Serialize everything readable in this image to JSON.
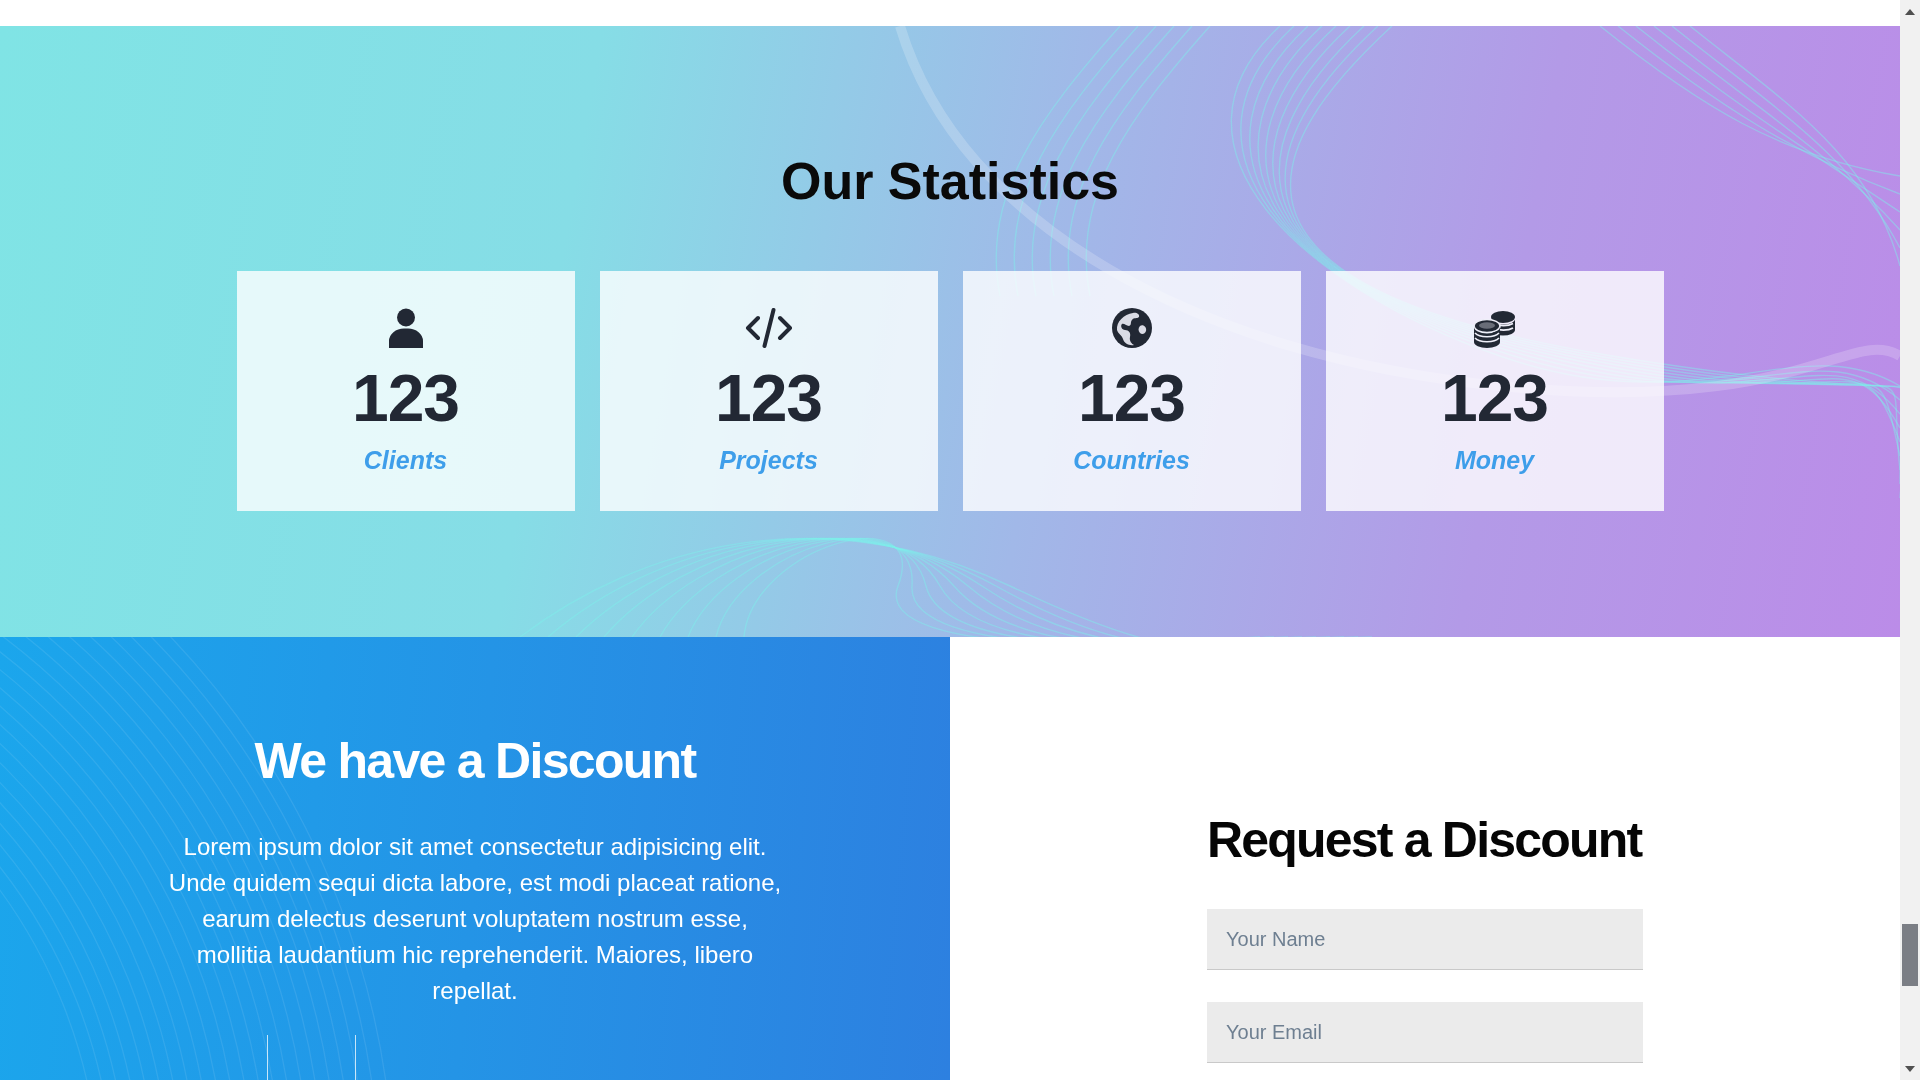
{
  "statistics": {
    "title": "Our Statistics",
    "cards": [
      {
        "value": "123",
        "label": "Clients"
      },
      {
        "value": "123",
        "label": "Projects"
      },
      {
        "value": "123",
        "label": "Countries"
      },
      {
        "value": "123",
        "label": "Money"
      }
    ]
  },
  "discount": {
    "title": "We have a Discount",
    "text": "Lorem ipsum dolor sit amet consectetur adipisicing elit. Unde quidem sequi dicta labore, est modi placeat ratione, earum delectus deserunt voluptatem nostrum esse, mollitia laudantium hic reprehenderit. Maiores, libero repellat."
  },
  "request_form": {
    "title": "Request a Discount",
    "fields": [
      {
        "placeholder": "Your Name"
      },
      {
        "placeholder": "Your Email"
      }
    ]
  }
}
